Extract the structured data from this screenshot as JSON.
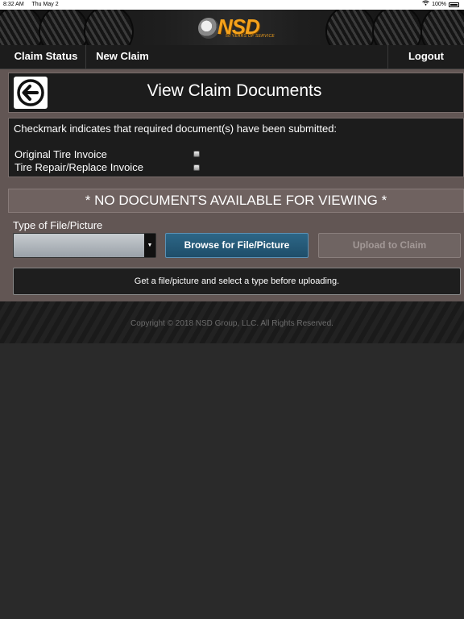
{
  "status_bar": {
    "time": "8:32 AM",
    "date": "Thu May 2",
    "battery": "100%"
  },
  "logo": {
    "brand": "NSD",
    "tagline": "50 YEARS OF SERVICE"
  },
  "nav": {
    "claim_status": "Claim Status",
    "new_claim": "New Claim",
    "logout": "Logout"
  },
  "page": {
    "title": "View Claim Documents",
    "back_icon": "arrow-left-circle-icon",
    "requirements_heading": "Checkmark indicates that required document(s) have been submitted:",
    "required_documents": [
      {
        "label": "Original Tire Invoice",
        "submitted": false
      },
      {
        "label": "Tire Repair/Replace Invoice",
        "submitted": false
      }
    ],
    "no_documents_message": "* NO DOCUMENTS AVAILABLE FOR VIEWING *",
    "type_label": "Type of File/Picture",
    "type_select_value": "",
    "browse_label": "Browse for File/Picture",
    "upload_label": "Upload to Claim",
    "hint_message": "Get a file/picture and select a type before uploading."
  },
  "footer": {
    "copyright": "Copyright © 2018 NSD Group, LLC. All Rights Reserved."
  },
  "colors": {
    "accent": "#f5a21b",
    "browse_button": "#245a7a",
    "panel": "#625654"
  }
}
